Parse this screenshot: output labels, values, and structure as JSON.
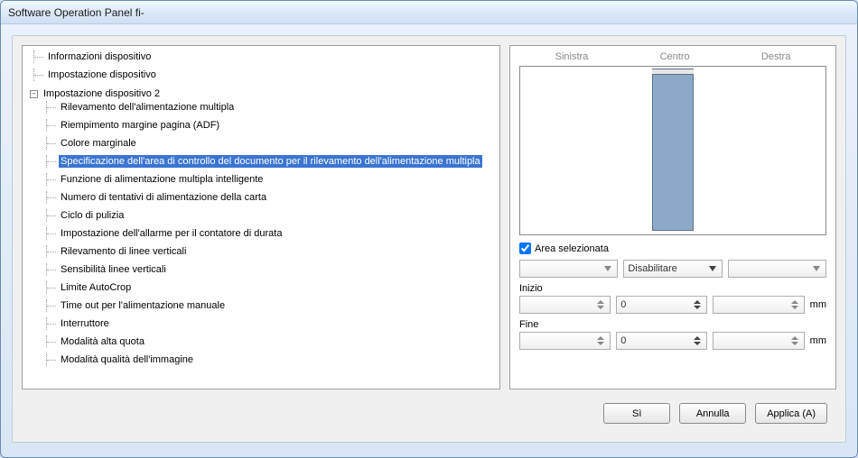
{
  "window": {
    "title": "Software Operation Panel fi-"
  },
  "tree": {
    "items": [
      {
        "label": "Informazioni dispositivo"
      },
      {
        "label": "Impostazione dispositivo"
      },
      {
        "label": "Impostazione dispositivo 2",
        "expanded": true,
        "children": [
          {
            "label": "Rilevamento dell'alimentazione multipla"
          },
          {
            "label": "Riempimento margine pagina (ADF)"
          },
          {
            "label": "Colore marginale"
          },
          {
            "label": "Specificazione dell'area di controllo del documento per il rilevamento dell'alimentazione multipla",
            "selected": true
          },
          {
            "label": "Funzione di alimentazione multipla intelligente"
          },
          {
            "label": "Numero di tentativi di alimentazione della carta"
          },
          {
            "label": "Ciclo di pulizia"
          },
          {
            "label": "Impostazione dell'allarme per il contatore di durata"
          },
          {
            "label": "Rilevamento di linee verticali"
          },
          {
            "label": "Sensibilità linee verticali"
          },
          {
            "label": "Limite AutoCrop"
          },
          {
            "label": "Time out per l'alimentazione manuale"
          },
          {
            "label": "Interruttore"
          },
          {
            "label": "Modalità alta quota"
          },
          {
            "label": "Modalità qualità dell'immagine"
          }
        ]
      }
    ]
  },
  "right": {
    "columns": {
      "left": "Sinistra",
      "center": "Centro",
      "right": "Destra"
    },
    "area_checkbox_label": "Area selezionata",
    "area_checked": true,
    "combo_center": "Disabilitare",
    "start_label": "Inizio",
    "start_center": "0",
    "end_label": "Fine",
    "end_center": "0",
    "unit": "mm"
  },
  "buttons": {
    "ok": "Sì",
    "cancel": "Annulla",
    "apply": "Applica (A)"
  }
}
